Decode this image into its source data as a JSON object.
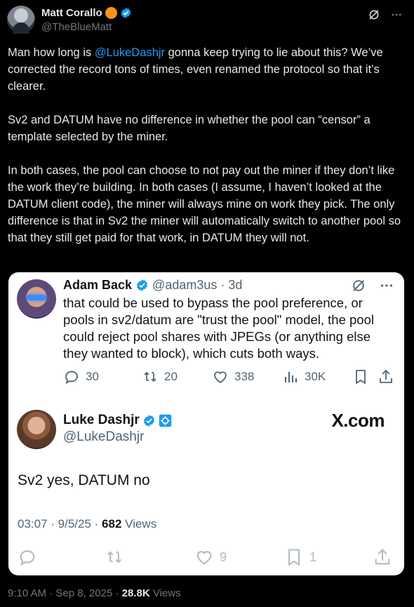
{
  "tweet": {
    "display_name": "Matt Corallo",
    "handle": "@TheBlueMatt",
    "text_p1_before": "Man how long is ",
    "mention": "@LukeDashjr",
    "text_p1_after": " gonna keep trying to lie about this? We’ve corrected the record tons of times, even renamed the protocol so that it’s clearer.",
    "text_p2": "Sv2 and DATUM have no difference in whether the pool can “censor” a template selected by the miner.",
    "text_p3": "In both cases, the pool can choose to not pay out the miner if they don’t like the work they’re building. In both cases (I assume, I haven’t looked at the DATUM client code), the miner will always mine on work they pick. The only difference is that in Sv2 the miner will automatically switch to another pool so that they still get paid for that work, in DATUM they will not.",
    "time": "9:10 AM",
    "date": "Sep 8, 2025",
    "views_count": "28.8K",
    "views_label": "Views"
  },
  "quoted": {
    "name": "Adam Back",
    "handle": "@adam3us",
    "age": "· 3d",
    "text": "that could be used to bypass the pool preference, or pools in sv2/datum are \"trust the pool\" model, the pool could reject pool shares with JPEGs (or anything else they wanted to block), which cuts both ways.",
    "replies": "30",
    "reposts": "20",
    "likes": "338",
    "views": "30K"
  },
  "luke": {
    "name": "Luke Dashjr",
    "handle": "@LukeDashjr",
    "brand": "X.com",
    "text": "Sv2 yes, DATUM no",
    "time": "03:07 · 9/5/25 ·",
    "views_count": "682",
    "views_label": "Views",
    "likes": "9",
    "bookmarks": "1"
  },
  "colors": {
    "accent": "#1d9bf0",
    "orange_badge": "#f7931a",
    "bg": "#000000",
    "embed_bg": "#ffffff"
  },
  "icons": [
    "verified-icon",
    "grok-icon",
    "more-icon",
    "reply-icon",
    "repost-icon",
    "like-icon",
    "views-icon",
    "bookmark-icon",
    "share-icon"
  ]
}
